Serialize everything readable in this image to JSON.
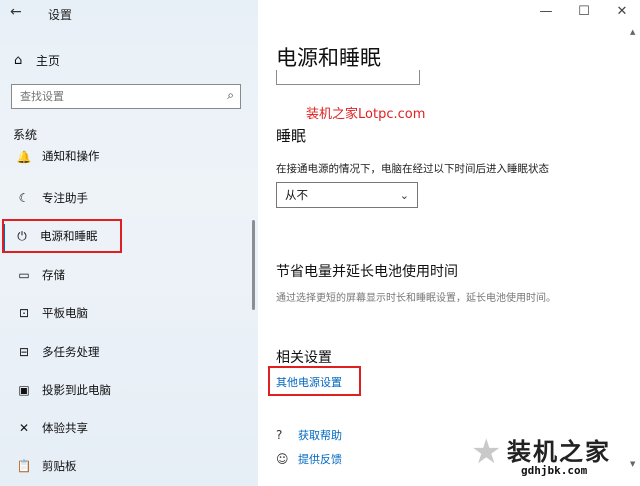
{
  "window": {
    "title": "设置",
    "back_icon": "←",
    "minimize": "—",
    "maximize": "☐",
    "close": "✕"
  },
  "sidebar": {
    "home": {
      "icon": "⌂",
      "label": "主页"
    },
    "search_placeholder": "查找设置",
    "search_icon": "⌕",
    "section": "系统",
    "items": [
      {
        "icon": "🔔",
        "label": "通知和操作",
        "clipped": true
      },
      {
        "icon": "☾",
        "label": "专注助手"
      },
      {
        "icon": "⏻",
        "label": "电源和睡眠",
        "selected": true
      },
      {
        "icon": "▭",
        "label": "存储"
      },
      {
        "icon": "⊡",
        "label": "平板电脑"
      },
      {
        "icon": "⊟",
        "label": "多任务处理"
      },
      {
        "icon": "▣",
        "label": "投影到此电脑"
      },
      {
        "icon": "✕",
        "label": "体验共享"
      },
      {
        "icon": "📋",
        "label": "剪贴板"
      }
    ]
  },
  "main": {
    "title": "电源和睡眠",
    "watermark_text": "装机之家Lotpc.com",
    "sleep": {
      "heading": "睡眠",
      "desc": "在接通电源的情况下，电脑在经过以下时间后进入睡眠状态",
      "value": "从不",
      "chevron": "⌄"
    },
    "battery": {
      "heading": "节省电量并延长电池使用时间",
      "desc": "通过选择更短的屏幕显示时长和睡眠设置，延长电池使用时间。"
    },
    "related": {
      "heading": "相关设置",
      "link": "其他电源设置"
    },
    "help": {
      "icon": "?",
      "label": "获取帮助"
    },
    "feedback": {
      "icon": "☺",
      "label": "提供反馈"
    }
  },
  "logo": {
    "text": "装机之家",
    "url": "gdhjbk.com"
  },
  "colors": {
    "accent": "#0067c0",
    "highlight_red": "#e02020"
  }
}
